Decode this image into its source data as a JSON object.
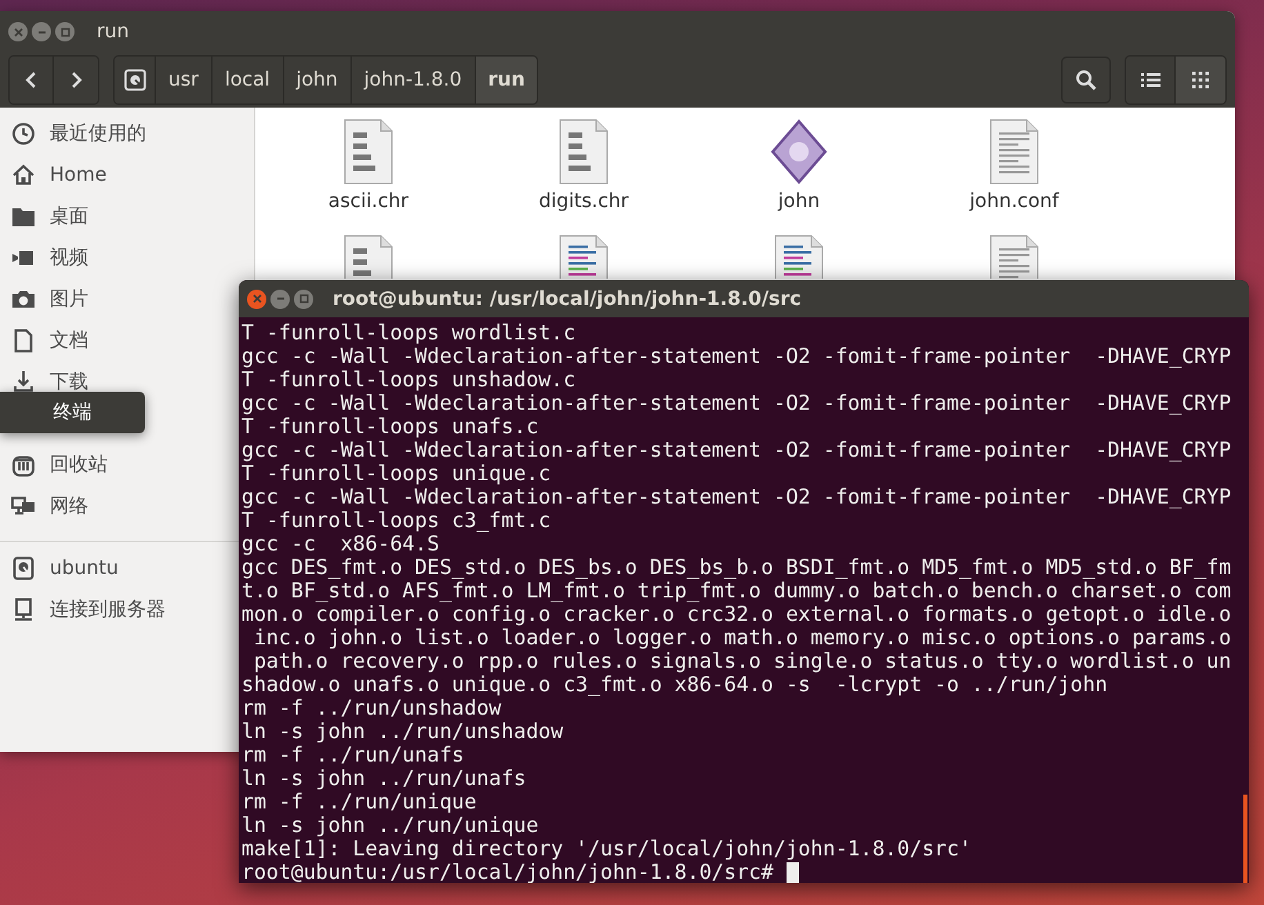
{
  "file_manager": {
    "title": "run",
    "path": [
      {
        "label": "usr",
        "selected": false
      },
      {
        "label": "local",
        "selected": false
      },
      {
        "label": "john",
        "selected": false
      },
      {
        "label": "john-1.8.0",
        "selected": false
      },
      {
        "label": "run",
        "selected": true
      }
    ],
    "views": [
      {
        "kind": "list",
        "selected": false
      },
      {
        "kind": "grid",
        "selected": true
      }
    ],
    "sidebar": {
      "places": [
        {
          "label": "最近使用的",
          "kind": "recent"
        },
        {
          "label": "Home",
          "kind": "home"
        },
        {
          "label": "桌面",
          "kind": "folder"
        },
        {
          "label": "视频",
          "kind": "video"
        },
        {
          "label": "图片",
          "kind": "camera"
        },
        {
          "label": "文档",
          "kind": "document"
        },
        {
          "label": "下载",
          "kind": "download"
        },
        {
          "kind": "hidden"
        },
        {
          "label": "回收站",
          "kind": "trash"
        },
        {
          "label": "网络",
          "kind": "network"
        }
      ],
      "devices": [
        {
          "label": "ubuntu",
          "kind": "drive"
        },
        {
          "label": "连接到服务器",
          "kind": "server"
        }
      ]
    },
    "tooltip": "终端",
    "files": [
      {
        "name": "ascii.chr",
        "kind": "binary"
      },
      {
        "name": "digits.chr",
        "kind": "binary"
      },
      {
        "name": "john",
        "kind": "executable"
      },
      {
        "name": "john.conf",
        "kind": "text"
      },
      {
        "kind": "binary"
      },
      {
        "kind": "code"
      },
      {
        "kind": "code"
      },
      {
        "kind": "text"
      }
    ]
  },
  "terminal": {
    "title": "root@ubuntu: /usr/local/john/john-1.8.0/src",
    "lines": [
      "T -funroll-loops wordlist.c",
      "gcc -c -Wall -Wdeclaration-after-statement -O2 -fomit-frame-pointer  -DHAVE_CRYP",
      "T -funroll-loops unshadow.c",
      "gcc -c -Wall -Wdeclaration-after-statement -O2 -fomit-frame-pointer  -DHAVE_CRYP",
      "T -funroll-loops unafs.c",
      "gcc -c -Wall -Wdeclaration-after-statement -O2 -fomit-frame-pointer  -DHAVE_CRYP",
      "T -funroll-loops unique.c",
      "gcc -c -Wall -Wdeclaration-after-statement -O2 -fomit-frame-pointer  -DHAVE_CRYP",
      "T -funroll-loops c3_fmt.c",
      "gcc -c  x86-64.S",
      "gcc DES_fmt.o DES_std.o DES_bs.o DES_bs_b.o BSDI_fmt.o MD5_fmt.o MD5_std.o BF_fm",
      "t.o BF_std.o AFS_fmt.o LM_fmt.o trip_fmt.o dummy.o batch.o bench.o charset.o com",
      "mon.o compiler.o config.o cracker.o crc32.o external.o formats.o getopt.o idle.o",
      " inc.o john.o list.o loader.o logger.o math.o memory.o misc.o options.o params.o",
      " path.o recovery.o rpp.o rules.o signals.o single.o status.o tty.o wordlist.o un",
      "shadow.o unafs.o unique.o c3_fmt.o x86-64.o -s  -lcrypt -o ../run/john",
      "rm -f ../run/unshadow",
      "ln -s john ../run/unshadow",
      "rm -f ../run/unafs",
      "ln -s john ../run/unafs",
      "rm -f ../run/unique",
      "ln -s john ../run/unique",
      "make[1]: Leaving directory '/usr/local/john/john-1.8.0/src'"
    ],
    "prompt": "root@ubuntu:/usr/local/john/john-1.8.0/src#"
  }
}
